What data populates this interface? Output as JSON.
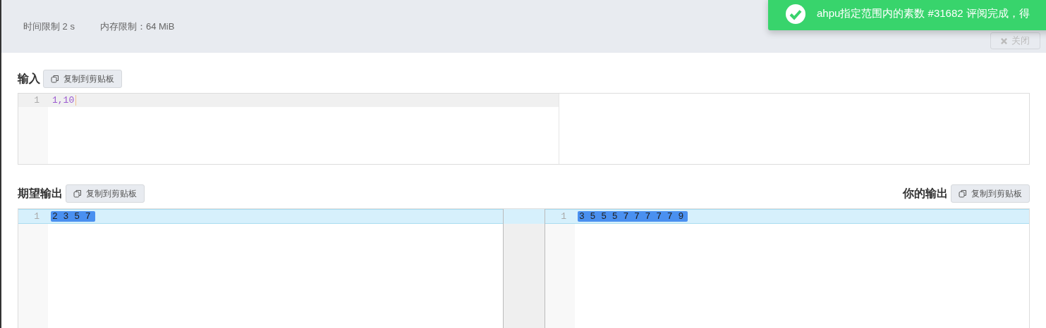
{
  "header": {
    "time_limit": "时间限制 2 s",
    "memory_limit": "内存限制：64 MiB",
    "close_button": "关闭"
  },
  "toast": {
    "kind": "success",
    "message": "ahpu指定范围内的素数 #31682 评阅完成，得"
  },
  "input": {
    "title": "输入",
    "copy_button": "复制到剪贴板",
    "lines": [
      {
        "number": "1",
        "text": "1,10"
      }
    ]
  },
  "expected_output": {
    "title": "期望输出",
    "copy_button": "复制到剪贴板",
    "lines": [
      {
        "number": "1",
        "text": "2 3 5 7",
        "changed": true
      }
    ]
  },
  "your_output": {
    "title": "你的输出",
    "copy_button": "复制到剪贴板",
    "lines": [
      {
        "number": "1",
        "text": "3 5 5 5 7 7 7 7 7 9",
        "changed": true
      }
    ]
  }
}
